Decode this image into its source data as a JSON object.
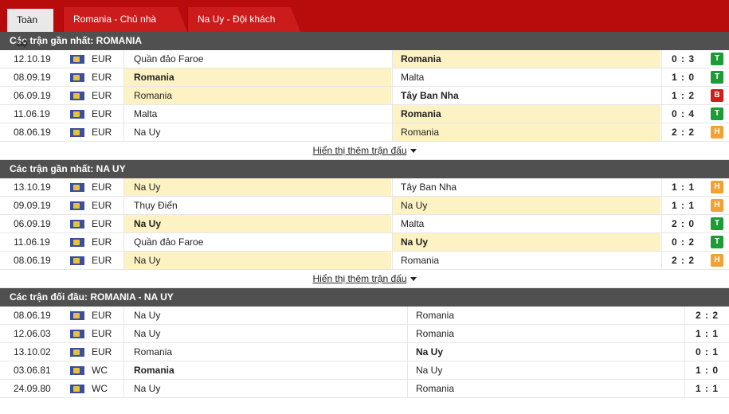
{
  "tabs": [
    {
      "label": "Toàn bộ"
    },
    {
      "label": "Romania - Chủ nhà"
    },
    {
      "label": "Na Uy - Đội khách"
    }
  ],
  "show_more_label": "Hiển thị thêm trận đấu",
  "sections": [
    {
      "title": "Các trận gần nhất: ROMANIA",
      "rows": [
        {
          "date": "12.10.19",
          "comp": "EUR",
          "home": "Quần đảo Faroe",
          "away": "Romania",
          "score": "0 : 3",
          "result": "T"
        },
        {
          "date": "08.09.19",
          "comp": "EUR",
          "home": "Romania",
          "away": "Malta",
          "score": "1 : 0",
          "result": "T"
        },
        {
          "date": "06.09.19",
          "comp": "EUR",
          "home": "Romania",
          "away": "Tây Ban Nha",
          "score": "1 : 2",
          "result": "B"
        },
        {
          "date": "11.06.19",
          "comp": "EUR",
          "home": "Malta",
          "away": "Romania",
          "score": "0 : 4",
          "result": "T"
        },
        {
          "date": "08.06.19",
          "comp": "EUR",
          "home": "Na Uy",
          "away": "Romania",
          "score": "2 : 2",
          "result": "H"
        }
      ]
    },
    {
      "title": "Các trận gần nhất: NA UY",
      "rows": [
        {
          "date": "13.10.19",
          "comp": "EUR",
          "home": "Na Uy",
          "away": "Tây Ban Nha",
          "score": "1 : 1",
          "result": "H"
        },
        {
          "date": "09.09.19",
          "comp": "EUR",
          "home": "Thụy Điển",
          "away": "Na Uy",
          "score": "1 : 1",
          "result": "H"
        },
        {
          "date": "06.09.19",
          "comp": "EUR",
          "home": "Na Uy",
          "away": "Malta",
          "score": "2 : 0",
          "result": "T"
        },
        {
          "date": "11.06.19",
          "comp": "EUR",
          "home": "Quần đảo Faroe",
          "away": "Na Uy",
          "score": "0 : 2",
          "result": "T"
        },
        {
          "date": "08.06.19",
          "comp": "EUR",
          "home": "Na Uy",
          "away": "Romania",
          "score": "2 : 2",
          "result": "H"
        }
      ]
    },
    {
      "title": "Các trận đối đầu: ROMANIA - NA UY",
      "rows": [
        {
          "date": "08.06.19",
          "comp": "EUR",
          "home": "Na Uy",
          "away": "Romania",
          "score": "2 : 2"
        },
        {
          "date": "12.06.03",
          "comp": "EUR",
          "home": "Na Uy",
          "away": "Romania",
          "score": "1 : 1"
        },
        {
          "date": "13.10.02",
          "comp": "EUR",
          "home": "Romania",
          "away": "Na Uy",
          "score": "0 : 1"
        },
        {
          "date": "03.06.81",
          "comp": "WC",
          "home": "Romania",
          "away": "Na Uy",
          "score": "1 : 0"
        },
        {
          "date": "24.09.80",
          "comp": "WC",
          "home": "Na Uy",
          "away": "Romania",
          "score": "1 : 1"
        }
      ]
    }
  ]
}
